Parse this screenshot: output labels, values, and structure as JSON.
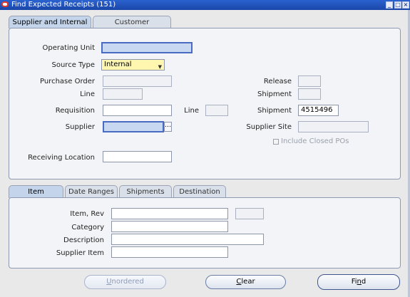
{
  "window": {
    "title": "Find Expected Receipts (151)"
  },
  "top_tabs": [
    {
      "label": "Supplier and Internal",
      "active": true
    },
    {
      "label": "Customer",
      "active": false
    }
  ],
  "supplier_section": {
    "operating_unit": {
      "label": "Operating Unit",
      "value": ""
    },
    "source_type": {
      "label": "Source Type",
      "value": "Internal"
    },
    "purchase_order": {
      "label": "Purchase Order",
      "value": ""
    },
    "po_line": {
      "label": "Line",
      "value": ""
    },
    "release": {
      "label": "Release",
      "value": ""
    },
    "po_shipment": {
      "label": "Shipment",
      "value": ""
    },
    "requisition": {
      "label": "Requisition",
      "value": ""
    },
    "req_line": {
      "label": "Line",
      "value": ""
    },
    "req_shipment": {
      "label": "Shipment",
      "value": "4515496"
    },
    "supplier": {
      "label": "Supplier",
      "value": ""
    },
    "supplier_site": {
      "label": "Supplier Site",
      "value": ""
    },
    "include_closed": {
      "label": "Include Closed POs",
      "checked": false
    },
    "receiving_location": {
      "label": "Receiving Location",
      "value": ""
    }
  },
  "bottom_tabs": [
    {
      "label": "Item",
      "active": true
    },
    {
      "label": "Date Ranges",
      "active": false
    },
    {
      "label": "Shipments",
      "active": false
    },
    {
      "label": "Destination",
      "active": false
    }
  ],
  "item_section": {
    "item_rev": {
      "label": "Item, Rev",
      "value": "",
      "rev_value": ""
    },
    "category": {
      "label": "Category",
      "value": ""
    },
    "description": {
      "label": "Description",
      "value": ""
    },
    "supplier_item": {
      "label": "Supplier Item",
      "value": ""
    }
  },
  "buttons": {
    "unordered": {
      "mnemonic": "U",
      "rest": "nordered",
      "enabled": false
    },
    "clear": {
      "mnemonic": "C",
      "rest": "lear",
      "enabled": true
    },
    "find": {
      "prefix": "Fi",
      "mnemonic": "n",
      "rest": "d",
      "enabled": true
    }
  },
  "colors": {
    "title_bar": "#1f4fb8",
    "required_field": "#c7d8f0",
    "source_type_field": "#fff7b0"
  }
}
